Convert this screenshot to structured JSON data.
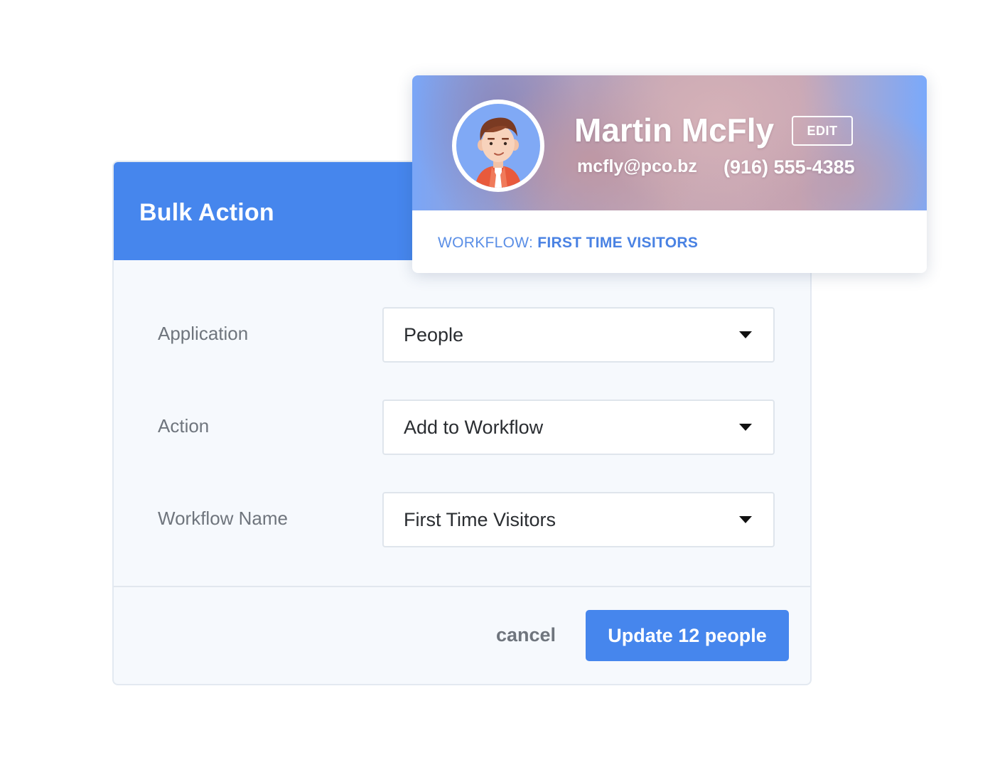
{
  "bulk_action": {
    "title": "Bulk Action",
    "fields": [
      {
        "label": "Application",
        "value": "People"
      },
      {
        "label": "Action",
        "value": "Add to Workflow"
      },
      {
        "label": "Workflow Name",
        "value": "First Time Visitors"
      }
    ],
    "cancel_label": "cancel",
    "submit_label": "Update 12 people"
  },
  "profile": {
    "name": "Martin McFly",
    "edit_label": "EDIT",
    "email": "mcfly@pco.bz",
    "phone": "(916) 555-4385",
    "workflow_prefix": "WORKFLOW:",
    "workflow_value": "FIRST TIME VISITORS",
    "avatar_icon": "person-avatar-icon"
  },
  "colors": {
    "primary": "#4686ed",
    "panel_bg": "#f6f9fd",
    "label_text": "#6f757d",
    "workflow_text": "#4a82e3"
  }
}
